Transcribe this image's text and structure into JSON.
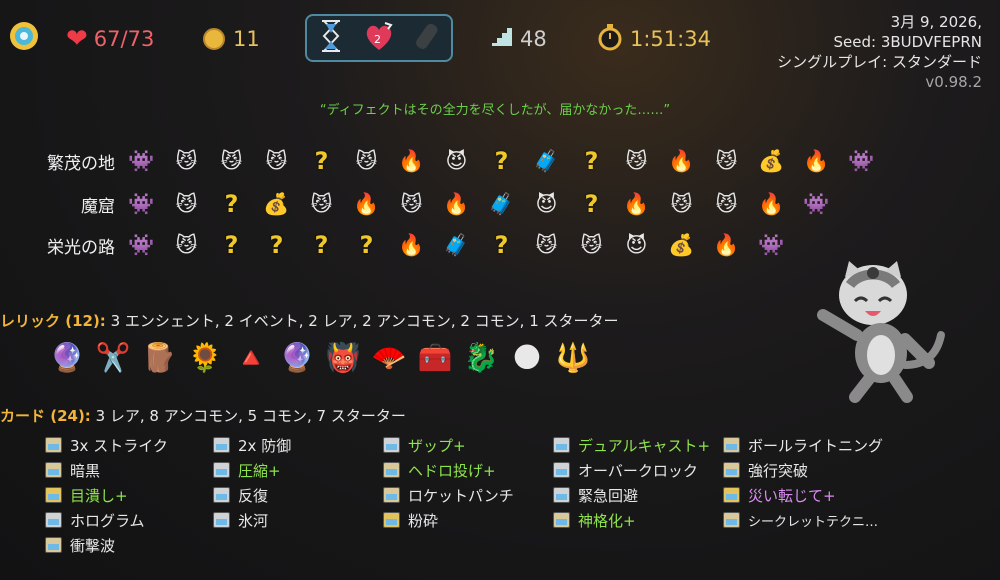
{
  "header": {
    "hp": "67/73",
    "gold": "11",
    "floor": "48",
    "time": "1:51:34",
    "potions": [
      "hourglass-potion-icon",
      "heart-potion-icon",
      "empty-potion-slot-icon"
    ]
  },
  "run_info": {
    "date": "3月 9, 2026,",
    "seed": "Seed: 3BUDVFEPRN",
    "mode": "シングルプレイ: スタンダード",
    "version": "v0.98.2"
  },
  "quote": "“ディフェクトはその全力を尽くしたが、届かなかった……”",
  "acts": [
    {
      "name": "繁茂の地",
      "nodes": [
        "boss",
        "monster",
        "monster",
        "monster",
        "unknown",
        "monster",
        "rest",
        "elite",
        "unknown",
        "shop",
        "unknown",
        "monster",
        "rest",
        "monster",
        "treasure",
        "rest",
        "boss"
      ]
    },
    {
      "name": "魔窟",
      "nodes": [
        "boss",
        "monster",
        "unknown",
        "treasure",
        "monster",
        "rest",
        "monster",
        "rest",
        "shop",
        "elite",
        "unknown",
        "rest",
        "monster",
        "monster",
        "rest",
        "boss"
      ]
    },
    {
      "name": "栄光の路",
      "nodes": [
        "boss",
        "monster",
        "unknown",
        "unknown",
        "unknown",
        "unknown",
        "rest",
        "shop",
        "unknown",
        "monster",
        "monster",
        "elite",
        "treasure",
        "rest",
        "boss"
      ]
    }
  ],
  "relics_section": {
    "label": "レリック (12):",
    "summary": " 3 エンシェント, 2 イベント, 2 レア, 2 アンコモン, 2 コモン, 1 スターター",
    "items": [
      "🔮",
      "✂️",
      "🪵",
      "🌻",
      "🔺",
      "🔮",
      "👹",
      "🪭",
      "🧰",
      "🐉",
      "🌑",
      "🔱"
    ]
  },
  "cards_section": {
    "label": "カード (24):",
    "summary": " 3 レア, 8 アンコモン, 5 コモン, 7 スターター",
    "cards": [
      {
        "name": "3x ストライク",
        "kind": "atk",
        "style": ""
      },
      {
        "name": "暗黒",
        "kind": "atk",
        "style": ""
      },
      {
        "name": "目潰し+",
        "kind": "pow",
        "style": "up"
      },
      {
        "name": "ホログラム",
        "kind": "skl",
        "style": ""
      },
      {
        "name": "衝撃波",
        "kind": "atk",
        "style": ""
      },
      {
        "name": "2x 防御",
        "kind": "skl",
        "style": ""
      },
      {
        "name": "圧縮+",
        "kind": "skl",
        "style": "up"
      },
      {
        "name": "反復",
        "kind": "skl",
        "style": ""
      },
      {
        "name": "氷河",
        "kind": "skl",
        "style": ""
      },
      {
        "name": "ザップ+",
        "kind": "skl",
        "style": "up"
      },
      {
        "name": "ヘドロ投げ+",
        "kind": "atk",
        "style": "up"
      },
      {
        "name": "ロケットパンチ",
        "kind": "atk",
        "style": ""
      },
      {
        "name": "粉砕",
        "kind": "pow",
        "style": ""
      },
      {
        "name": "デュアルキャスト+",
        "kind": "skl",
        "style": "up"
      },
      {
        "name": "オーバークロック",
        "kind": "skl",
        "style": ""
      },
      {
        "name": "緊急回避",
        "kind": "skl",
        "style": ""
      },
      {
        "name": "神格化+",
        "kind": "atk",
        "style": "up"
      },
      {
        "name": "ボールライトニング",
        "kind": "atk",
        "style": ""
      },
      {
        "name": "強行突破",
        "kind": "atk",
        "style": ""
      },
      {
        "name": "災い転じて+",
        "kind": "pow",
        "style": "curse"
      },
      {
        "name": "シークレットテクニ…",
        "kind": "atk",
        "style": "small"
      }
    ]
  }
}
